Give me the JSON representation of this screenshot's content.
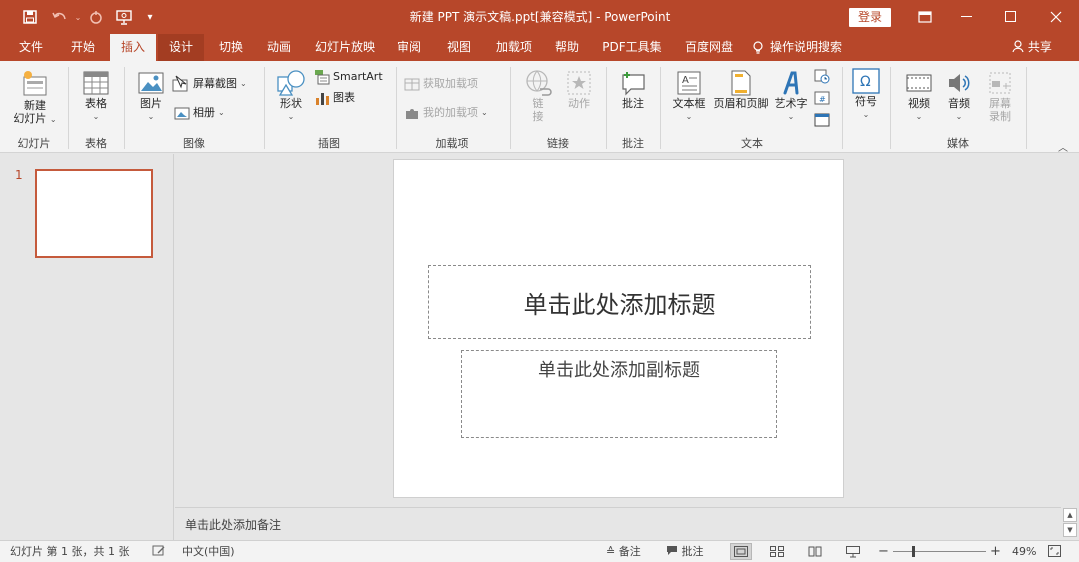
{
  "titlebar": {
    "title": "新建 PPT 演示文稿.ppt[兼容模式] - PowerPoint",
    "login": "登录",
    "qa_icons": [
      "save-icon",
      "undo-icon",
      "redo-icon",
      "present-icon",
      "customize-icon"
    ]
  },
  "tabs": [
    "文件",
    "开始",
    "插入",
    "设计",
    "切换",
    "动画",
    "幻灯片放映",
    "审阅",
    "视图",
    "加载项",
    "帮助",
    "PDF工具集",
    "百度网盘"
  ],
  "tell_me": "操作说明搜索",
  "share": "共享",
  "ribbon": {
    "new_slide": [
      "新建",
      "幻灯片"
    ],
    "table": "表格",
    "image": "图片",
    "screenshot": "屏幕截图",
    "album": "相册",
    "shapes": "形状",
    "smartart": "SmartArt",
    "chart": "图表",
    "get_addins": "获取加载项",
    "my_addins": "我的加载项",
    "link": [
      "链",
      "接"
    ],
    "action": "动作",
    "comment": "批注",
    "textbox": "文本框",
    "header_footer": "页眉和页脚",
    "wordart": "艺术字",
    "symbol": "符号",
    "video": "视频",
    "audio": "音频",
    "screen_record": [
      "屏幕",
      "录制"
    ],
    "groups": {
      "slides": "幻灯片",
      "tables": "表格",
      "images": "图像",
      "illustrations": "插图",
      "addins": "加载项",
      "links": "链接",
      "comments": "批注",
      "text": "文本",
      "media": "媒体"
    }
  },
  "slide": {
    "number": "1",
    "title_placeholder": "单击此处添加标题",
    "subtitle_placeholder": "单击此处添加副标题"
  },
  "notes_placeholder": "单击此处添加备注",
  "status": {
    "slide_info": "幻灯片 第 1 张，共 1 张",
    "language": "中文(中国)",
    "notes": "备注",
    "comments": "批注",
    "zoom_minus": "−",
    "zoom_plus": "+",
    "zoom": "49%"
  },
  "colors": {
    "accent": "#b7472a",
    "ribbon_bg": "#f3f3f3",
    "workspace_bg": "#e6e6e6"
  }
}
